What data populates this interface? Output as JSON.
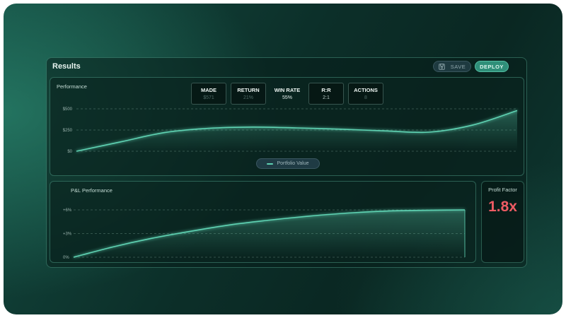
{
  "results": {
    "title": "Results",
    "save_label": "SAVE",
    "deploy_label": "DEPLOY"
  },
  "performance": {
    "label": "Performance",
    "stats": [
      {
        "title": "MADE",
        "value": "$571"
      },
      {
        "title": "RETURN",
        "value": "21%"
      },
      {
        "title": "WIN RATE",
        "value": "55%"
      },
      {
        "title": "R:R",
        "value": "2:1"
      },
      {
        "title": "ACTIONS",
        "value": "8"
      }
    ],
    "legend": "Portfolio Value"
  },
  "pnl": {
    "label": "P&L Performance"
  },
  "profit_factor": {
    "label": "Profit Factor",
    "value": "1.8x"
  },
  "colors": {
    "accent": "#5fd3b3",
    "profit_factor": "#ee5b63"
  },
  "icons": {
    "save": "save-icon"
  },
  "chart_data": [
    {
      "type": "area",
      "ylim": [
        0,
        500
      ],
      "yticks": [
        "$500",
        "$250",
        "$0"
      ],
      "ytick_values": [
        500,
        250,
        0
      ],
      "x": [
        0,
        0.1,
        0.2,
        0.3,
        0.4,
        0.5,
        0.6,
        0.7,
        0.8,
        0.9,
        1.0
      ],
      "values": [
        0,
        110,
        220,
        270,
        285,
        275,
        260,
        240,
        225,
        310,
        480
      ],
      "legend": "Portfolio Value",
      "grid": true
    },
    {
      "type": "area",
      "ylim": [
        0,
        6
      ],
      "yticks": [
        "+6%",
        "+3%",
        "0%"
      ],
      "ytick_values": [
        6,
        3,
        0
      ],
      "x": [
        0,
        0.1,
        0.2,
        0.3,
        0.4,
        0.5,
        0.6,
        0.7,
        0.8,
        0.9,
        1.0
      ],
      "values": [
        0,
        1.3,
        2.4,
        3.3,
        4.1,
        4.7,
        5.2,
        5.6,
        5.85,
        5.95,
        6.0
      ],
      "grid": true
    }
  ]
}
